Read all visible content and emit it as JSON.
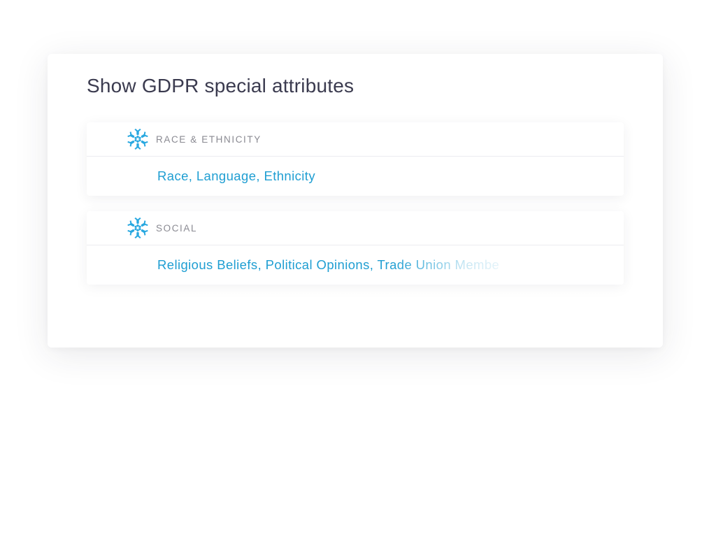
{
  "page": {
    "title": "Show GDPR special attributes"
  },
  "colors": {
    "accent": "#1f9ed2",
    "icon": "#29a8e0",
    "title_text": "#3b3b4f",
    "category_text": "#8a8a92"
  },
  "categories": [
    {
      "icon": "snowflake-icon",
      "label": "RACE & ETHNICITY",
      "attributes": "Race, Language, Ethnicity"
    },
    {
      "icon": "snowflake-icon",
      "label": "SOCIAL",
      "attributes": "Religious Beliefs, Political Opinions, Trade Union Membe"
    }
  ]
}
